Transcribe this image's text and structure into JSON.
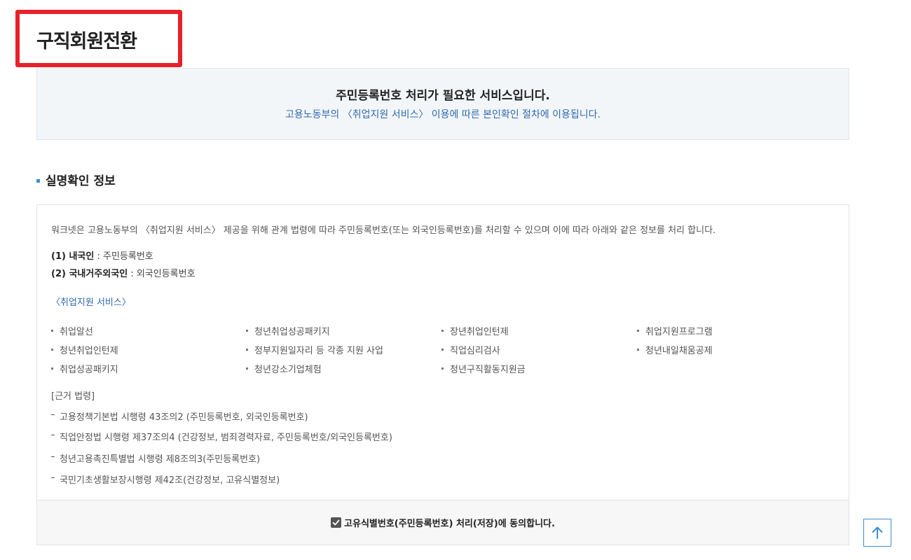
{
  "page": {
    "title": "구직회원전환"
  },
  "notice": {
    "title": "주민등록번호 처리가 필요한 서비스입니다.",
    "subtitle": "고용노동부의 〈취업지원 서비스〉 이용에 따른 본인확인 절차에 이용됩니다."
  },
  "section": {
    "title": "실명확인 정보"
  },
  "info": {
    "intro": "워크넷은 고용노동부의 〈취업지원 서비스〉 제공을 위해 관계 법령에 따라 주민등록번호(또는 외국인등록번호)를 처리할 수 있으며 이에 따라 아래와 같은 정보를 처리 합니다.",
    "categories": [
      {
        "label": "(1) 내국인",
        "value": " : 주민등록번호"
      },
      {
        "label": "(2) 국내거주외국인",
        "value": " : 외국인등록번호"
      }
    ],
    "services_title": "〈취업지원 서비스〉",
    "services": [
      "취업알선",
      "청년취업성공패키지",
      "장년취업인턴제",
      "취업지원프로그램",
      "청년취업인턴제",
      "정부지원일자리 등 각종 지원 사업",
      "직업심리검사",
      "청년내일채움공제",
      "취업성공패키지",
      "청년강소기업체험",
      "청년구직활동지원금"
    ],
    "laws_title": "[근거 법령]",
    "laws": [
      "고용정책기본법 시행령 43조의2 (주민등록번호, 외국인등록번호)",
      "직업안정법 시행령 제37조의4 (건강정보, 범죄경력자료, 주민등록번호/외국인등록번호)",
      "청년고용촉진특별법 시행령 제8조의3(주민등록번호)",
      "국민기초생활보장시행령 제42조(건강정보, 고유식별정보)"
    ]
  },
  "agree": {
    "label": "고유식별번호(주민등록번호) 처리(저장)에 동의합니다.",
    "checked": true
  },
  "colors": {
    "accent": "#2f6ab0",
    "highlight_border": "#e8202a",
    "bullet": "#3a8fd4"
  }
}
